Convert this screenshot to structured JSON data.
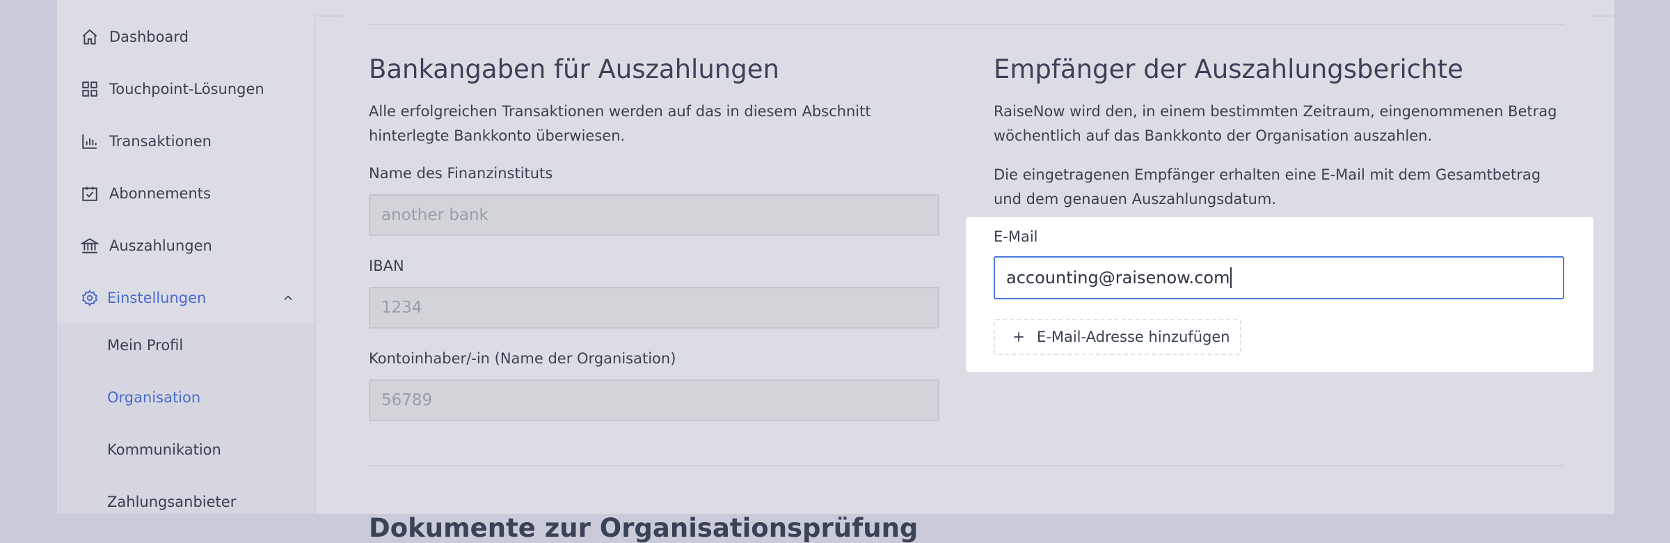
{
  "sidebar": {
    "items": [
      {
        "label": "Dashboard",
        "icon": "home-icon"
      },
      {
        "label": "Touchpoint-Lösungen",
        "icon": "grid-icon"
      },
      {
        "label": "Transaktionen",
        "icon": "bar-chart-icon"
      },
      {
        "label": "Abonnements",
        "icon": "calendar-check-icon"
      },
      {
        "label": "Auszahlungen",
        "icon": "bank-icon"
      },
      {
        "label": "Einstellungen",
        "icon": "gear-icon"
      }
    ],
    "submenu": [
      "Mein Profil",
      "Organisation",
      "Kommunikation",
      "Zahlungsanbieter"
    ],
    "active_submenu": "Organisation",
    "accent_color": "#4a6ad1"
  },
  "bank": {
    "title": "Bankangaben für Auszahlungen",
    "desc": "Alle erfolgreichen Transaktionen werden auf das in diesem Abschnitt hinterlegte Bankkonto überwiesen.",
    "institute_label": "Name des Finanzinstituts",
    "institute_value": "another bank",
    "iban_label": "IBAN",
    "iban_value": "1234",
    "holder_label": "Kontoinhaber/-in (Name der Organisation)",
    "holder_value": "56789"
  },
  "recipients": {
    "title": "Empfänger der Auszahlungsberichte",
    "desc1": "RaiseNow wird den, in einem bestimmten Zeitraum, eingenommenen Betrag wöchentlich auf das Bankkonto der Organisation auszahlen.",
    "desc2": "Die eingetragenen Empfänger erhalten eine E-Mail mit dem Gesamtbetrag und dem genauen Auszahlungsdatum.",
    "email_label": "E-Mail",
    "email_value": "accounting@raisenow.com",
    "add_label": "E-Mail-Adresse hinzufügen"
  },
  "documents": {
    "title": "Dokumente zur Organisationsprüfung"
  }
}
